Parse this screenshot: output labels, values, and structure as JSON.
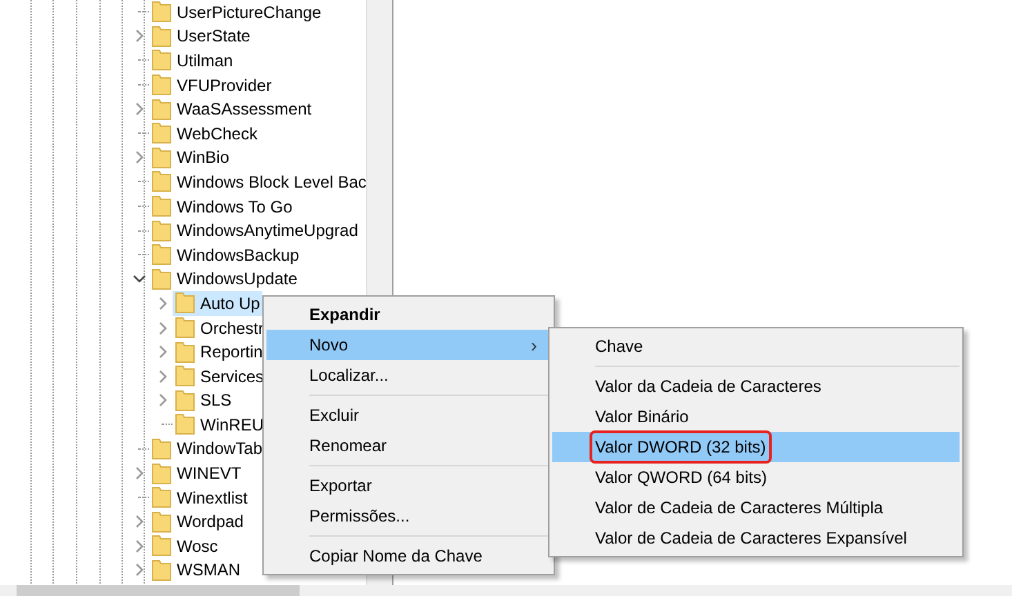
{
  "tree": [
    {
      "label": "UserPictureChange",
      "expandable": false,
      "selected": false
    },
    {
      "label": "UserState",
      "expandable": true,
      "selected": false
    },
    {
      "label": "Utilman",
      "expandable": false,
      "selected": false
    },
    {
      "label": "VFUProvider",
      "expandable": false,
      "selected": false
    },
    {
      "label": "WaaSAssessment",
      "expandable": true,
      "selected": false
    },
    {
      "label": "WebCheck",
      "expandable": false,
      "selected": false
    },
    {
      "label": "WinBio",
      "expandable": true,
      "selected": false
    },
    {
      "label": "Windows Block Level Bac",
      "expandable": false,
      "selected": false
    },
    {
      "label": "Windows To Go",
      "expandable": false,
      "selected": false
    },
    {
      "label": "WindowsAnytimeUpgrad",
      "expandable": false,
      "selected": false
    },
    {
      "label": "WindowsBackup",
      "expandable": false,
      "selected": false
    },
    {
      "label": "WindowsUpdate",
      "expandable": true,
      "expanded": true,
      "selected": false,
      "children": [
        {
          "label": "Auto Up",
          "expandable": true,
          "selected": true
        },
        {
          "label": "Orchestr",
          "expandable": true,
          "selected": false
        },
        {
          "label": "Reportin",
          "expandable": true,
          "selected": false
        },
        {
          "label": "Services",
          "expandable": true,
          "selected": false
        },
        {
          "label": "SLS",
          "expandable": true,
          "selected": false
        },
        {
          "label": "WinREU",
          "expandable": false,
          "selected": false
        }
      ]
    },
    {
      "label": "WindowTab",
      "expandable": false,
      "selected": false
    },
    {
      "label": "WINEVT",
      "expandable": true,
      "selected": false
    },
    {
      "label": "Winextlist",
      "expandable": false,
      "selected": false
    },
    {
      "label": "Wordpad",
      "expandable": true,
      "selected": false
    },
    {
      "label": "Wosc",
      "expandable": true,
      "selected": false
    },
    {
      "label": "WSMAN",
      "expandable": true,
      "selected": false
    }
  ],
  "context_menu": [
    {
      "kind": "item",
      "label": "Expandir",
      "bold": true,
      "selected": false
    },
    {
      "kind": "item",
      "label": "Novo",
      "submenu": true,
      "selected": true
    },
    {
      "kind": "item",
      "label": "Localizar...",
      "selected": false
    },
    {
      "kind": "separator"
    },
    {
      "kind": "item",
      "label": "Excluir",
      "selected": false
    },
    {
      "kind": "item",
      "label": "Renomear",
      "selected": false
    },
    {
      "kind": "separator"
    },
    {
      "kind": "item",
      "label": "Exportar",
      "selected": false
    },
    {
      "kind": "item",
      "label": "Permissões...",
      "selected": false
    },
    {
      "kind": "separator"
    },
    {
      "kind": "item",
      "label": "Copiar Nome da Chave",
      "selected": false
    }
  ],
  "submenu_arrow": "›",
  "submenu": [
    {
      "kind": "item",
      "label": "Chave",
      "selected": false,
      "outlined": false
    },
    {
      "kind": "separator"
    },
    {
      "kind": "item",
      "label": "Valor da Cadeia de Caracteres",
      "selected": false,
      "outlined": false
    },
    {
      "kind": "item",
      "label": "Valor Binário",
      "selected": false,
      "outlined": false
    },
    {
      "kind": "item",
      "label": "Valor DWORD (32 bits)",
      "selected": true,
      "outlined": true
    },
    {
      "kind": "item",
      "label": "Valor QWORD (64 bits)",
      "selected": false,
      "outlined": false
    },
    {
      "kind": "item",
      "label": "Valor de Cadeia de Caracteres Múltipla",
      "selected": false,
      "outlined": false
    },
    {
      "kind": "item",
      "label": "Valor de Cadeia de Caracteres Expansível",
      "selected": false,
      "outlined": false
    }
  ]
}
